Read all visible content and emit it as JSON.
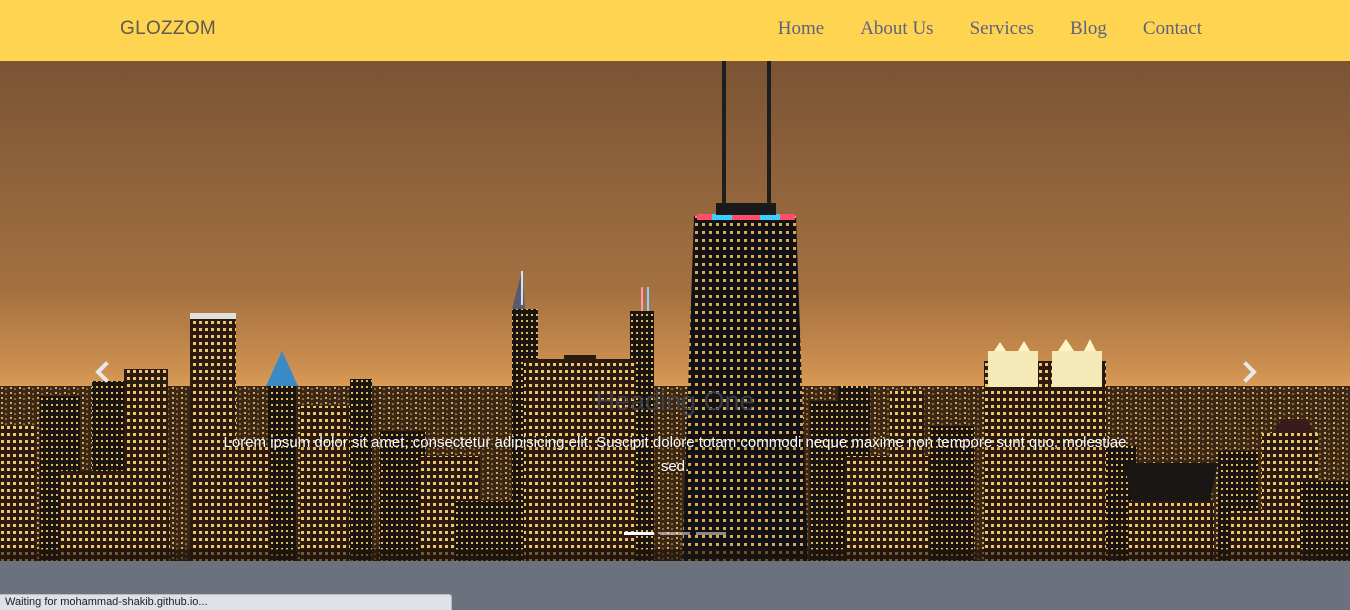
{
  "navbar": {
    "brand": "GLOZZOM",
    "links": [
      "Home",
      "About Us",
      "Services",
      "Blog",
      "Contact"
    ],
    "background_color": "#ffd450"
  },
  "carousel": {
    "prev_icon": "chevron-left-icon",
    "next_icon": "chevron-right-icon",
    "slide": {
      "heading": "Heading One",
      "text": "Lorem ipsum dolor sit amet, consectetur adipisicing elit. Suscipit dolore totam commodi neque maxime non tempore sunt quo, molestiae sed."
    },
    "indicator_count": 3,
    "active_indicator": 1
  },
  "status_bar": {
    "text": "Waiting for mohammad-shakib.github.io..."
  },
  "colors": {
    "page_background": "#6b727e",
    "sky_top": "#7a5434",
    "sky_horizon": "#c8894a"
  }
}
